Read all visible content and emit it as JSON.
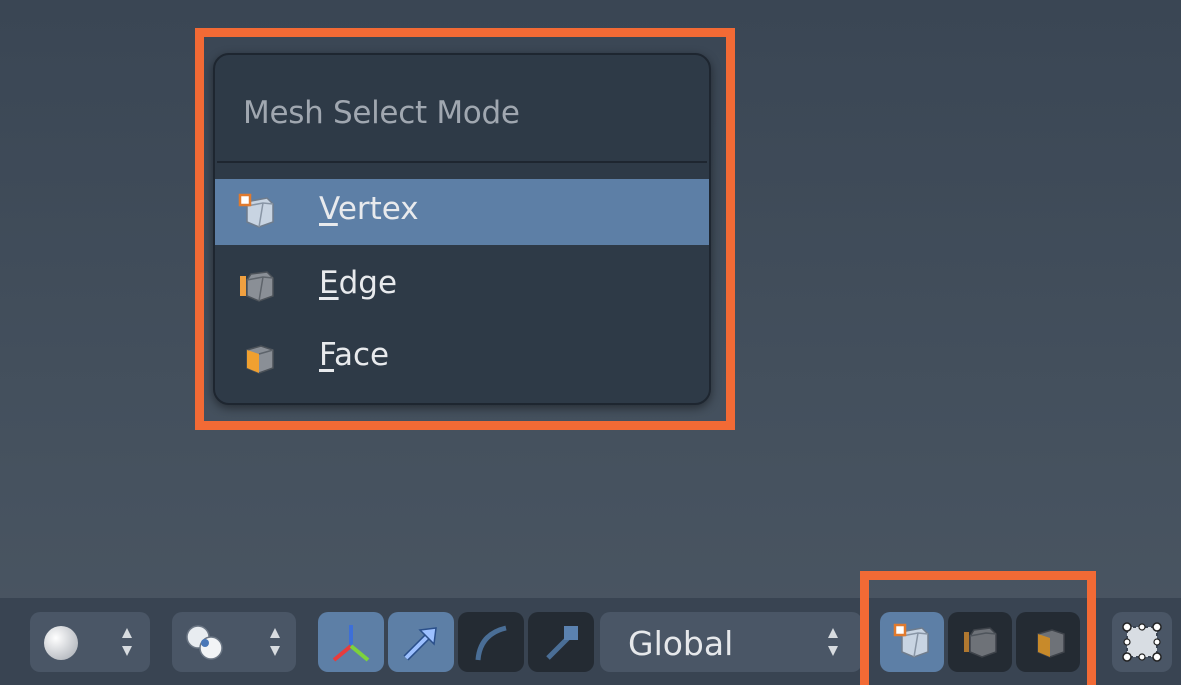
{
  "menu": {
    "title": "Mesh Select Mode",
    "items": [
      {
        "underline": "V",
        "rest": "ertex",
        "icon": "vertex-select-icon",
        "active": true
      },
      {
        "underline": "E",
        "rest": "dge",
        "icon": "edge-select-icon",
        "active": false
      },
      {
        "underline": "F",
        "rest": "ace",
        "icon": "face-select-icon",
        "active": false
      }
    ]
  },
  "toolbar": {
    "orientation": "Global"
  },
  "colors": {
    "highlight": "#f26a35",
    "selected": "#5d7fa6",
    "menu_bg": "#2e3a47"
  }
}
